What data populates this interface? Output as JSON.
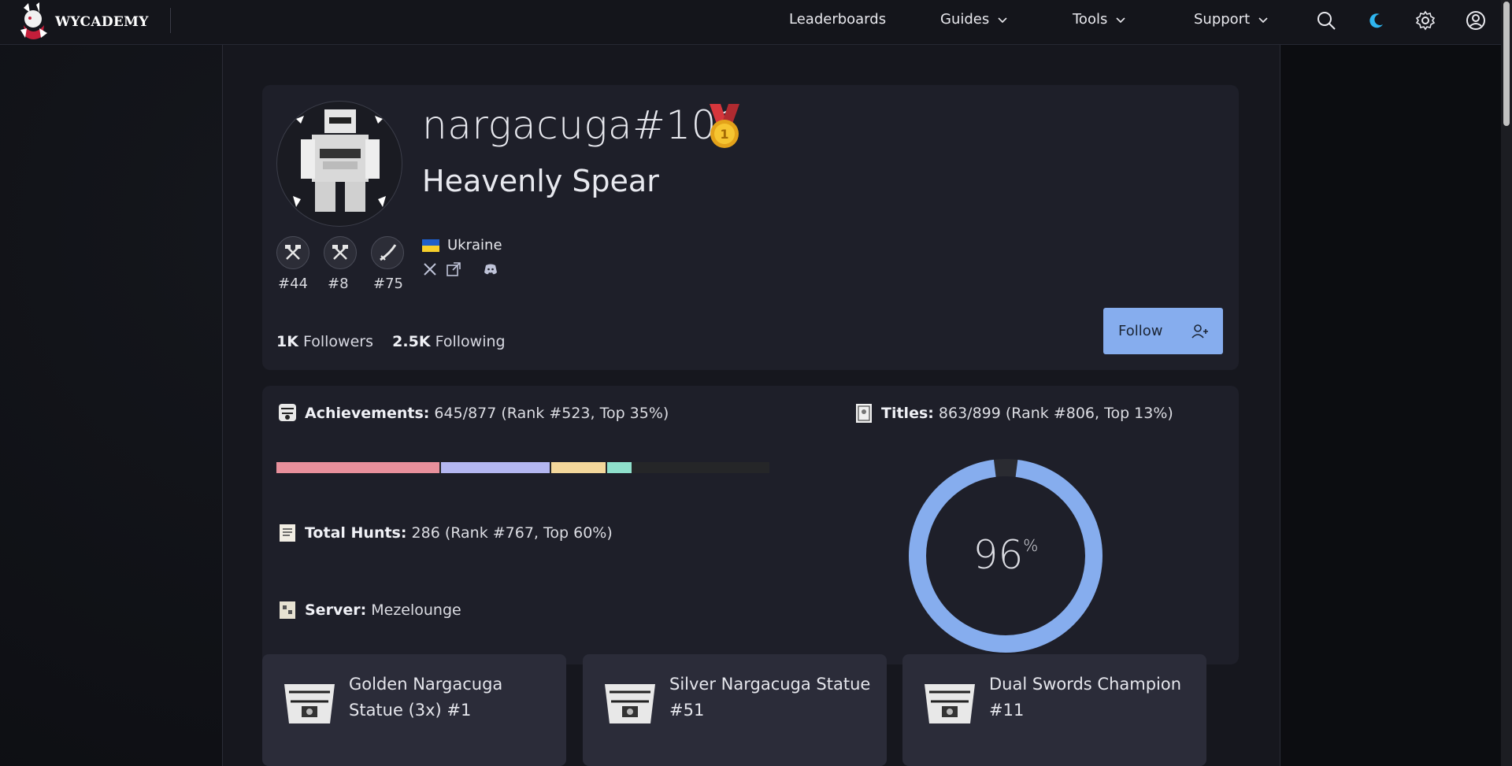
{
  "brand": {
    "name": "WYCADEMY"
  },
  "nav": {
    "leaderboards": "Leaderboards",
    "guides": "Guides",
    "tools": "Tools",
    "support": "Support"
  },
  "profile": {
    "username": "nargacuga#101",
    "title": "Heavenly Spear",
    "weapon_ranks": [
      "#44",
      "#8",
      "#75"
    ],
    "country": "Ukraine",
    "followers_count": "1K",
    "followers_label": "Followers",
    "following_count": "2.5K",
    "following_label": "Following",
    "follow_label": "Follow"
  },
  "stats": {
    "achievements_label": "Achievements:",
    "achievements_value": "645/877 (Rank #523, Top 35%)",
    "achievements_bar": [
      {
        "color": "#e8909c",
        "fraction": 0.33
      },
      {
        "color": "#b4b7f1",
        "fraction": 0.22
      },
      {
        "color": "#f3d79b",
        "fraction": 0.11
      },
      {
        "color": "#8fe0cc",
        "fraction": 0.05
      }
    ],
    "hunts_label": "Total Hunts:",
    "hunts_value": "286 (Rank #767, Top 60%)",
    "server_label": "Server:",
    "server_value": "Mezelounge",
    "titles_label": "Titles:",
    "titles_value": "863/899 (Rank #806, Top 13%)",
    "titles_percent": "96",
    "titles_percent_sign": "%",
    "titles_fraction": 0.96,
    "accent": "#86adee"
  },
  "achievements_list": [
    "Golden Nargacuga Statue (3x) #1",
    "Silver Nargacuga Statue #51",
    "Dual Swords Champion #11"
  ]
}
